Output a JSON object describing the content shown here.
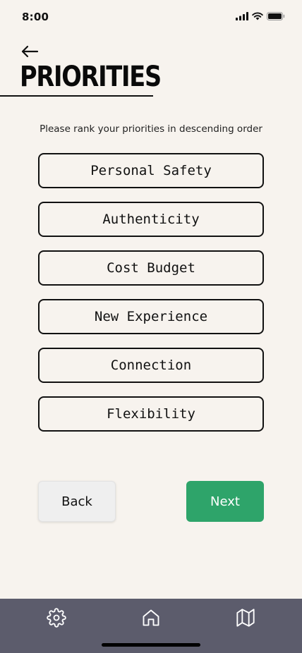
{
  "status_bar": {
    "time": "8:00"
  },
  "header": {
    "back_icon": "arrow-left-icon",
    "title": "PRIORITIES"
  },
  "instructions": "Please rank your priorities in descending order",
  "priorities": [
    "Personal Safety",
    "Authenticity",
    "Cost Budget",
    "New Experience",
    "Connection",
    "Flexibility"
  ],
  "actions": {
    "back_label": "Back",
    "next_label": "Next",
    "next_color": "#2ea46a"
  },
  "bottom_nav": {
    "items": [
      "settings-icon",
      "home-icon",
      "map-icon"
    ],
    "background": "#5c5c6c"
  }
}
